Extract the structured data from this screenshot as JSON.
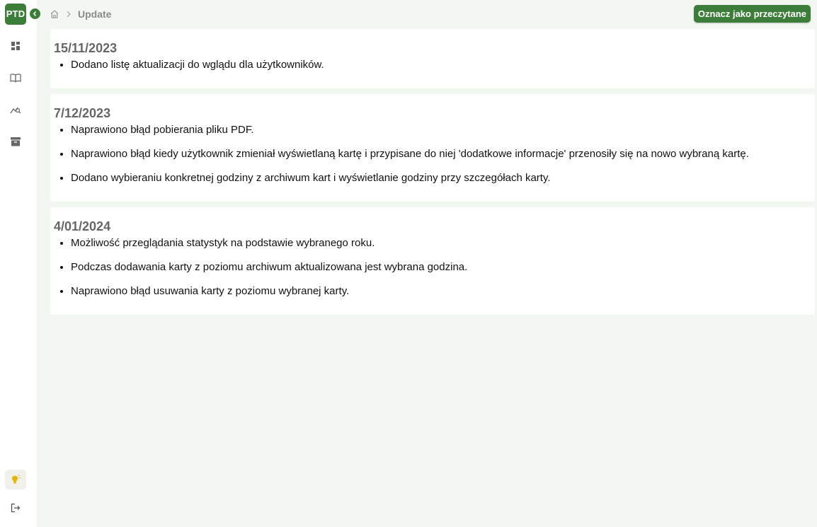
{
  "app": {
    "logo_text": "PTD"
  },
  "sidebar": {
    "items": [
      {
        "icon": "dashboard-icon"
      },
      {
        "icon": "book-icon"
      },
      {
        "icon": "chart-search-icon"
      },
      {
        "icon": "archive-icon"
      }
    ],
    "bottom": [
      {
        "icon": "lightbulb-icon",
        "active": true
      },
      {
        "icon": "logout-icon"
      }
    ]
  },
  "breadcrumb": {
    "home_icon": "home-icon",
    "current": "Update"
  },
  "toolbar": {
    "mark_read_label": "Oznacz jako przeczytane"
  },
  "colors": {
    "accent": "#3d7d3a",
    "background": "#f3f7f2",
    "lightbulb": "#e8b400"
  },
  "updates": [
    {
      "date": "15/11/2023",
      "items": [
        "Dodano listę aktualizacji do wglądu dla użytkowników."
      ]
    },
    {
      "date": "7/12/2023",
      "items": [
        "Naprawiono błąd pobierania pliku PDF.",
        "Naprawiono błąd kiedy użytkownik zmieniał wyświetlaną kartę i przypisane do niej 'dodatkowe informacje' przenosiły się na nowo wybraną kartę.",
        "Dodano wybieraniu konkretnej godziny z archiwum kart i wyświetlanie godziny przy szczegółach karty."
      ]
    },
    {
      "date": "4/01/2024",
      "items": [
        "Możliwość przeglądania statystyk na podstawie wybranego roku.",
        "Podczas dodawania karty z poziomu archiwum aktualizowana jest wybrana godzina.",
        "Naprawiono błąd usuwania karty z poziomu wybranej karty."
      ]
    }
  ]
}
